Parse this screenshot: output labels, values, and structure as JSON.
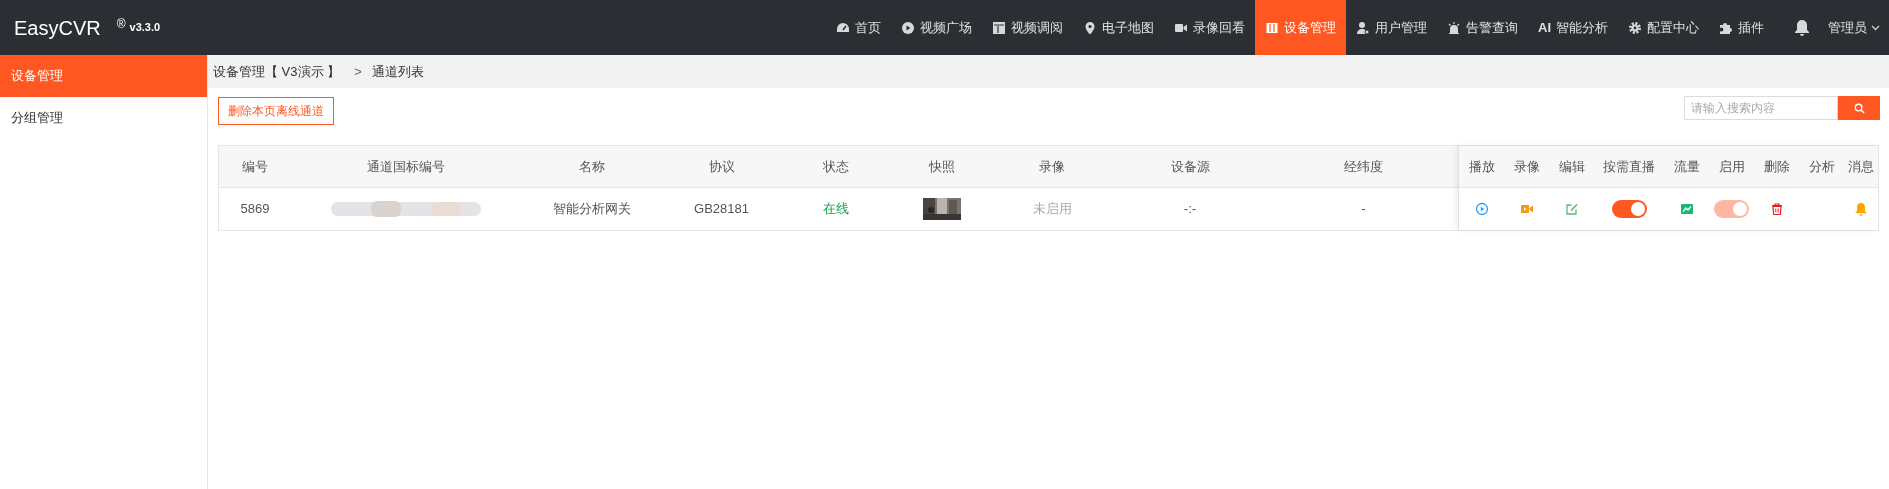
{
  "header": {
    "brand": "EasyCVR",
    "registered_mark": "®",
    "version": "v3.3.0",
    "nav": [
      {
        "label": "首页",
        "selected": false
      },
      {
        "label": "视频广场",
        "selected": false
      },
      {
        "label": "视频调阅",
        "selected": false
      },
      {
        "label": "电子地图",
        "selected": false
      },
      {
        "label": "录像回看",
        "selected": false
      },
      {
        "label": "设备管理",
        "selected": true
      },
      {
        "label": "用户管理",
        "selected": false
      },
      {
        "label": "告警查询",
        "selected": false
      },
      {
        "icon_text": "AI",
        "label": "智能分析",
        "selected": false
      },
      {
        "label": "配置中心",
        "selected": false
      },
      {
        "label": "插件",
        "selected": false
      }
    ],
    "user": "管理员"
  },
  "sidebar": {
    "items": [
      {
        "label": "设备管理",
        "selected": true
      },
      {
        "label": "分组管理",
        "selected": false
      }
    ]
  },
  "breadcrumb": {
    "root": "设备管理【 V3演示 】",
    "separator": ">",
    "current": "通道列表"
  },
  "toolbar": {
    "delete_button": "删除本页离线通道",
    "search": {
      "placeholder": "请输入搜索内容"
    }
  },
  "table": {
    "columns": [
      "编号",
      "通道国标编号",
      "名称",
      "协议",
      "状态",
      "快照",
      "录像",
      "设备源",
      "经纬度"
    ],
    "action_columns": [
      "播放",
      "录像",
      "编辑",
      "按需直播",
      "流量",
      "启用",
      "删除",
      "分析",
      "消息"
    ],
    "rows": [
      {
        "cells": [
          {
            "kind": "text",
            "text": "5869"
          },
          {
            "kind": "blurred"
          },
          {
            "kind": "text",
            "text": "智能分析网关"
          },
          {
            "kind": "text",
            "text": "GB28181"
          },
          {
            "kind": "online",
            "text": "在线"
          },
          {
            "kind": "picture"
          },
          {
            "kind": "muted",
            "text": "未启用"
          },
          {
            "kind": "text",
            "text": "-:-"
          },
          {
            "kind": "text",
            "text": "-"
          }
        ],
        "actions": [
          {
            "kind": "play"
          },
          {
            "kind": "record"
          },
          {
            "kind": "edit"
          },
          {
            "kind": "toggle",
            "on": true,
            "disabled": false
          },
          {
            "kind": "chart"
          },
          {
            "kind": "toggle",
            "on": true,
            "disabled": true
          },
          {
            "kind": "delete"
          },
          {
            "kind": "blank"
          },
          {
            "kind": "bell"
          }
        ]
      }
    ]
  }
}
